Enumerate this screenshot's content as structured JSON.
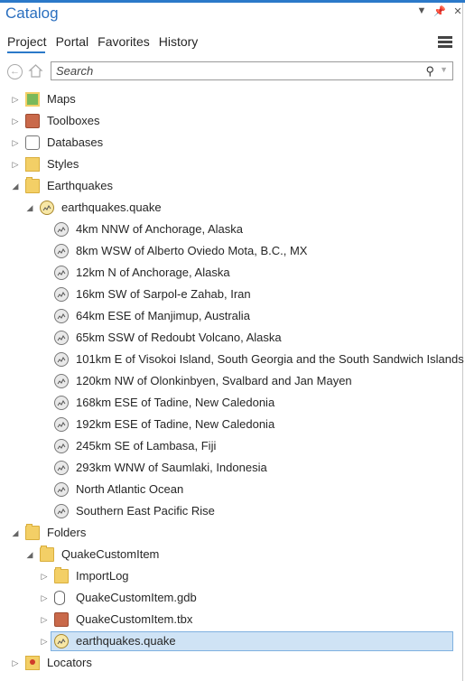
{
  "window": {
    "title": "Catalog"
  },
  "tabs": [
    "Project",
    "Portal",
    "Favorites",
    "History"
  ],
  "search": {
    "placeholder": "Search",
    "value": ""
  },
  "tree": [
    {
      "label": "Maps",
      "icon": "maps-icon",
      "level": 0,
      "expanded": false
    },
    {
      "label": "Toolboxes",
      "icon": "toolbox-icon",
      "level": 0,
      "expanded": false
    },
    {
      "label": "Databases",
      "icon": "database-icon",
      "level": 0,
      "expanded": false
    },
    {
      "label": "Styles",
      "icon": "styles-icon",
      "level": 0,
      "expanded": false
    },
    {
      "label": "Earthquakes",
      "icon": "folder-icon",
      "level": 0,
      "expanded": true
    },
    {
      "label": "earthquakes.quake",
      "icon": "quake-file-icon",
      "level": 1,
      "expanded": true
    },
    {
      "label": "4km NNW of Anchorage, Alaska",
      "icon": "quake-item-icon",
      "level": 2
    },
    {
      "label": "8km WSW of Alberto Oviedo Mota, B.C., MX",
      "icon": "quake-item-icon",
      "level": 2
    },
    {
      "label": "12km N of Anchorage, Alaska",
      "icon": "quake-item-icon",
      "level": 2
    },
    {
      "label": "16km SW of Sarpol-e Zahab, Iran",
      "icon": "quake-item-icon",
      "level": 2
    },
    {
      "label": "64km ESE of Manjimup, Australia",
      "icon": "quake-item-icon",
      "level": 2
    },
    {
      "label": "65km SSW of Redoubt Volcano, Alaska",
      "icon": "quake-item-icon",
      "level": 2
    },
    {
      "label": "101km E of Visokoi Island, South Georgia and the South Sandwich Islands",
      "icon": "quake-item-icon",
      "level": 2
    },
    {
      "label": "120km NW of Olonkinbyen, Svalbard and Jan Mayen",
      "icon": "quake-item-icon",
      "level": 2
    },
    {
      "label": "168km ESE of Tadine, New Caledonia",
      "icon": "quake-item-icon",
      "level": 2
    },
    {
      "label": "192km ESE of Tadine, New Caledonia",
      "icon": "quake-item-icon",
      "level": 2
    },
    {
      "label": "245km SE of Lambasa, Fiji",
      "icon": "quake-item-icon",
      "level": 2
    },
    {
      "label": "293km WNW of Saumlaki, Indonesia",
      "icon": "quake-item-icon",
      "level": 2
    },
    {
      "label": "North Atlantic Ocean",
      "icon": "quake-item-icon",
      "level": 2
    },
    {
      "label": "Southern East Pacific Rise",
      "icon": "quake-item-icon",
      "level": 2
    },
    {
      "label": "Folders",
      "icon": "folders-icon",
      "level": 0,
      "expanded": true
    },
    {
      "label": "QuakeCustomItem",
      "icon": "home-folder-icon",
      "level": 1,
      "expanded": true
    },
    {
      "label": "ImportLog",
      "icon": "folder-icon",
      "level": 2,
      "expanded": false
    },
    {
      "label": "QuakeCustomItem.gdb",
      "icon": "geodatabase-icon",
      "level": 2,
      "expanded": false
    },
    {
      "label": "QuakeCustomItem.tbx",
      "icon": "toolbox-icon",
      "level": 2,
      "expanded": false
    },
    {
      "label": "earthquakes.quake",
      "icon": "quake-file-icon",
      "level": 2,
      "expanded": false,
      "selected": true
    },
    {
      "label": "Locators",
      "icon": "locators-icon",
      "level": 0,
      "expanded": false
    }
  ]
}
